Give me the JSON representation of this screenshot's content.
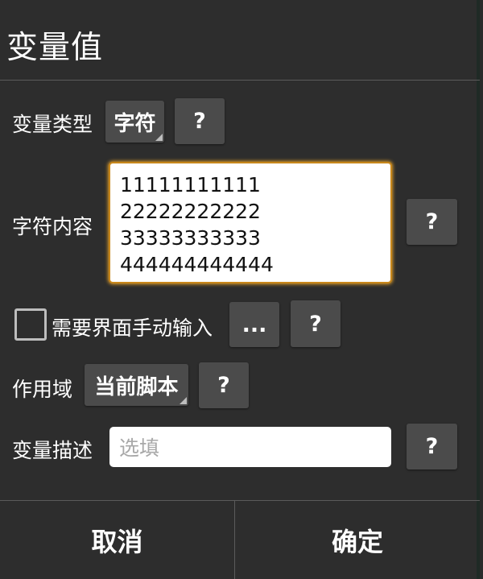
{
  "dialog": {
    "title": "变量值",
    "variable_type": {
      "label": "变量类型",
      "value": "字符",
      "help": "?"
    },
    "content": {
      "label": "字符内容",
      "lines": [
        "11111111111",
        "22222222222",
        "33333333333",
        "444444444444"
      ],
      "help": "?"
    },
    "manual_input": {
      "label": "需要界面手动输入",
      "checked": false,
      "more": "...",
      "help": "?"
    },
    "scope": {
      "label": "作用域",
      "value": "当前脚本",
      "help": "?"
    },
    "description": {
      "label": "变量描述",
      "placeholder": "选填",
      "value": "",
      "help": "?"
    },
    "buttons": {
      "cancel": "取消",
      "confirm": "确定"
    }
  },
  "colors": {
    "background": "#2d2d2d",
    "button": "#4b4b4b",
    "focus_border": "#c8871b"
  }
}
